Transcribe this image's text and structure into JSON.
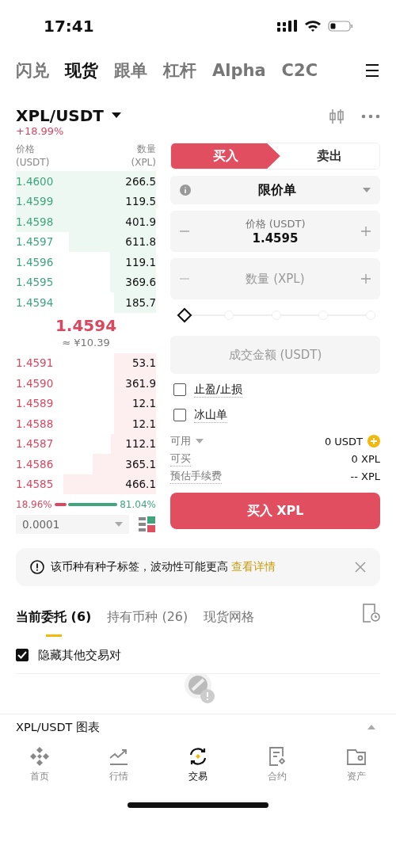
{
  "status_bar": {
    "time": "17:41"
  },
  "top_tabs": [
    {
      "label": "闪兑",
      "selected": false
    },
    {
      "label": "现货",
      "selected": true
    },
    {
      "label": "跟单",
      "selected": false
    },
    {
      "label": "杠杆",
      "selected": false
    },
    {
      "label": "Alpha",
      "selected": false
    },
    {
      "label": "C2C",
      "selected": false
    }
  ],
  "pair": {
    "name": "XPL/USDT",
    "change": "+18.99%"
  },
  "order_book": {
    "price_header": [
      "价格",
      "(USDT)"
    ],
    "qty_header": [
      "数量",
      "(XPL)"
    ],
    "asks": [
      {
        "price": "1.4600",
        "qty": "266.5"
      },
      {
        "price": "1.4599",
        "qty": "119.5"
      },
      {
        "price": "1.4598",
        "qty": "401.9"
      },
      {
        "price": "1.4597",
        "qty": "611.8"
      },
      {
        "price": "1.4596",
        "qty": "119.1"
      },
      {
        "price": "1.4595",
        "qty": "369.6"
      },
      {
        "price": "1.4594",
        "qty": "185.7"
      }
    ],
    "last_price": "1.4594",
    "fiat_price": "≈ ¥10.39",
    "bids": [
      {
        "price": "1.4591",
        "qty": "53.1"
      },
      {
        "price": "1.4590",
        "qty": "361.9"
      },
      {
        "price": "1.4589",
        "qty": "12.1"
      },
      {
        "price": "1.4588",
        "qty": "12.1"
      },
      {
        "price": "1.4587",
        "qty": "112.1"
      },
      {
        "price": "1.4586",
        "qty": "365.1"
      },
      {
        "price": "1.4585",
        "qty": "466.1"
      }
    ],
    "ratio": {
      "buy_label": "18.96%",
      "sell_label": "81.04%"
    },
    "precision": "0.0001"
  },
  "trade_form": {
    "sides": [
      {
        "label": "买入",
        "selected": true
      },
      {
        "label": "卖出",
        "selected": false
      }
    ],
    "order_type": "限价单",
    "price_label": "价格 (USDT)",
    "price_value": "1.4595",
    "qty_placeholder": "数量 (XPL)",
    "slider": {
      "level": 0
    },
    "total_placeholder": "成交金额 (USDT)",
    "options": [
      {
        "label": "止盈/止损",
        "checked": false
      },
      {
        "label": "冰山单",
        "checked": false
      }
    ],
    "info": [
      {
        "label": "可用",
        "value": "0 USDT"
      },
      {
        "label": "可买",
        "value": "0 XPL"
      },
      {
        "label": "预估手续费",
        "value": "-- XPL"
      }
    ],
    "submit": "买入 XPL"
  },
  "notice": {
    "text": "该币种有种子标签，波动性可能更高",
    "link": "查看详情"
  },
  "order_tabs": [
    {
      "label": "当前委托 (6)",
      "selected": true
    },
    {
      "label": "持有币种 (26)",
      "selected": false
    },
    {
      "label": "现货网格",
      "selected": false
    }
  ],
  "hide_other_pairs": {
    "label": "隐藏其他交易对",
    "checked": true
  },
  "chart_bar": {
    "label": "XPL/USDT 图表"
  },
  "bottom_nav": [
    {
      "label": "首页",
      "selected": false
    },
    {
      "label": "行情",
      "selected": false
    },
    {
      "label": "交易",
      "selected": true
    },
    {
      "label": "合约",
      "selected": false
    },
    {
      "label": "资产",
      "selected": false
    }
  ]
}
